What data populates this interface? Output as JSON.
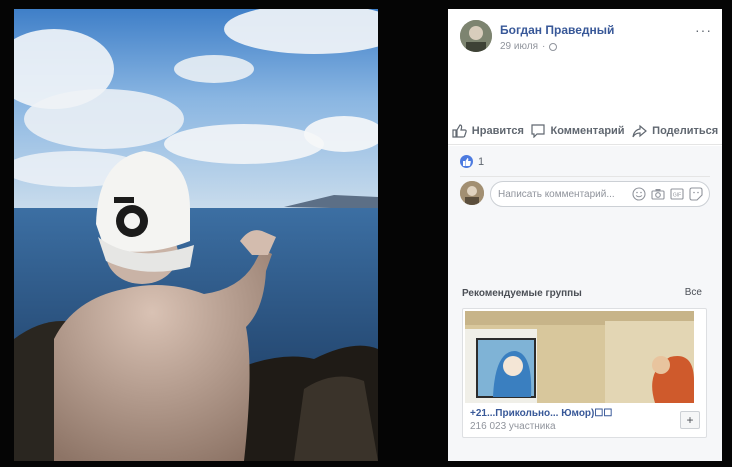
{
  "post": {
    "author": "Богдан Праведный",
    "date": "29 июля",
    "privacy_icon": "globe-icon",
    "more_label": "···"
  },
  "actions": {
    "like": "Нравится",
    "comment": "Комментарий",
    "share": "Поделиться"
  },
  "reactions": {
    "count": "1",
    "icon": "like-icon"
  },
  "comment_box": {
    "placeholder": "Написать комментарий...",
    "icons": [
      "emoji-icon",
      "camera-icon",
      "gif-icon",
      "sticker-icon"
    ]
  },
  "recommended": {
    "title": "Рекомендуемые группы",
    "all_label": "Все",
    "group": {
      "name": "+21...Прикольно... Юмор)☐☐",
      "members": "216 023 участника",
      "join_label": "+"
    }
  },
  "colors": {
    "link": "#385898",
    "like_badge": "#4d7be0"
  }
}
